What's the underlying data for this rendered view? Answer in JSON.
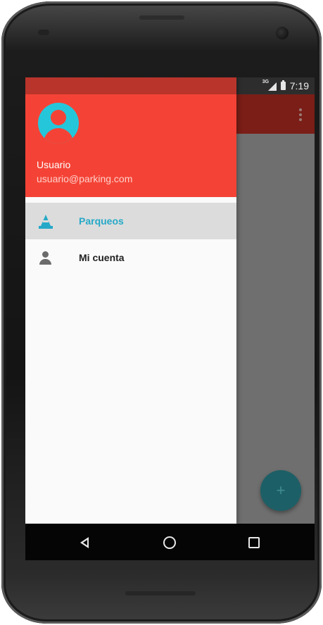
{
  "status_bar": {
    "network": "3G",
    "time": "7:19"
  },
  "drawer": {
    "header": {
      "user_name": "Usuario",
      "user_email": "usuario@parking.com",
      "header_color": "#f44336",
      "avatar_color": "#26c6da"
    },
    "items": [
      {
        "label": "Parqueos",
        "icon": "traffic-cone-icon",
        "active": true,
        "color": "#26a9c8"
      },
      {
        "label": "Mi cuenta",
        "icon": "person-icon",
        "active": false,
        "color": "#212121"
      }
    ]
  },
  "fab": {
    "icon": "plus-icon",
    "symbol": "+"
  },
  "toolbar": {
    "overflow_icon": "overflow-menu-icon"
  },
  "nav_bar": {
    "back_icon": "back-icon",
    "home_icon": "home-icon",
    "recent_icon": "recent-apps-icon"
  }
}
